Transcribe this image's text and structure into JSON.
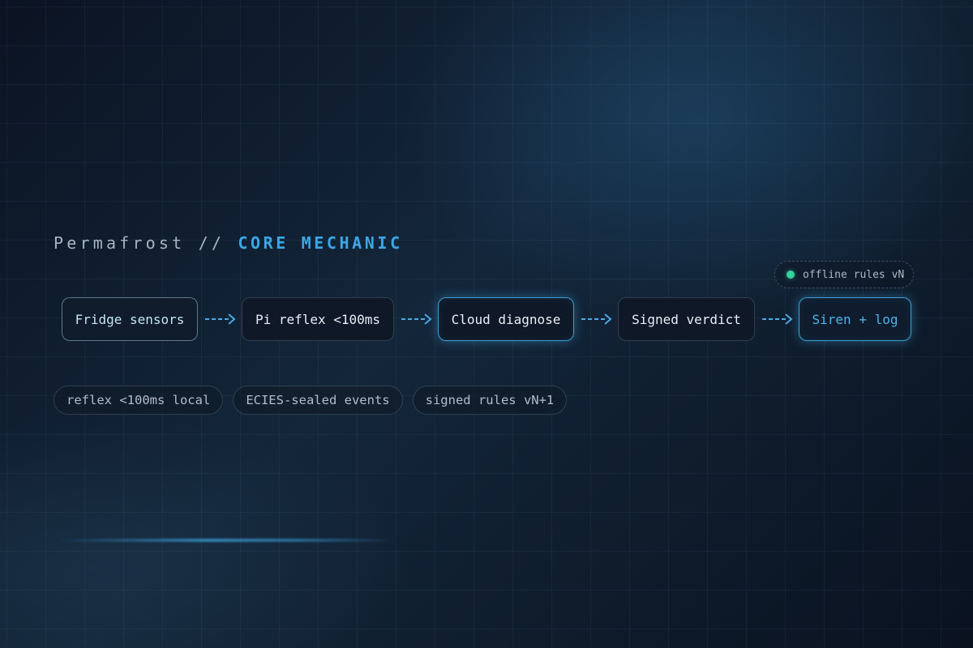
{
  "title": {
    "prefix": "Permafrost // ",
    "accent": "CORE MECHANIC"
  },
  "colors": {
    "accent": "#3da7e6",
    "status_online": "#34d39a",
    "background": "#0b1220"
  },
  "badge": {
    "status_icon": "status-dot-icon",
    "label": "offline rules vN"
  },
  "pipeline": {
    "arrow_icon": "dashed-arrow-right-icon",
    "nodes": [
      {
        "label": "Fridge sensors"
      },
      {
        "label": "Pi reflex <100ms"
      },
      {
        "label": "Cloud diagnose"
      },
      {
        "label": "Signed verdict"
      },
      {
        "label": "Siren + log"
      }
    ]
  },
  "tags": [
    {
      "label": "reflex <100ms local"
    },
    {
      "label": "ECIES-sealed events"
    },
    {
      "label": "signed rules vN+1"
    }
  ]
}
